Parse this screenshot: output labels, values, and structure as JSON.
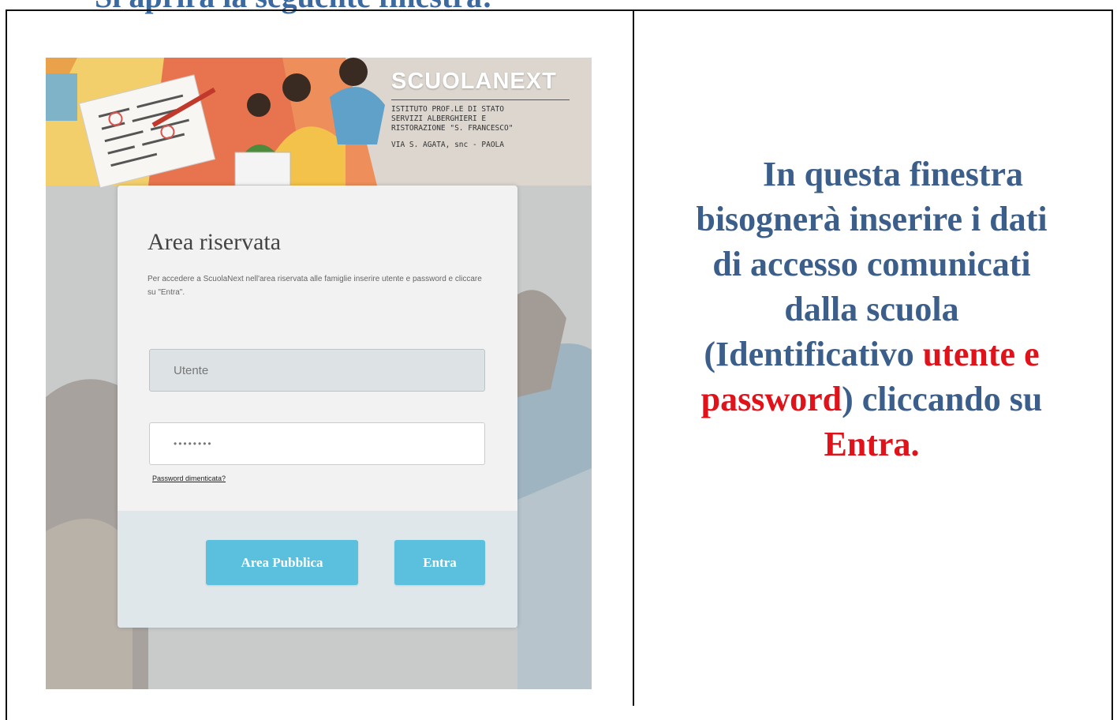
{
  "document": {
    "heading_fragment": "Si aprirà la seguente finestra:"
  },
  "screenshot": {
    "brand": {
      "logo_part1": "SCUOLA",
      "logo_part2": "NEXT"
    },
    "school": {
      "line1": "ISTITUTO PROF.LE DI STATO",
      "line2": "SERVIZI ALBERGHIERI E",
      "line3": "RISTORAZIONE \"S. FRANCESCO\"",
      "address": "VIA S. AGATA, snc - PAOLA"
    },
    "login": {
      "title": "Area riservata",
      "description": "Per accedere a ScuolaNext nell'area riservata alle famiglie inserire utente e password e cliccare su \"Entra\".",
      "username_placeholder": "Utente",
      "password_value": "••••••••",
      "forgot_link": "Password dimenticata?",
      "public_button": "Area Pubblica",
      "enter_button": "Entra"
    },
    "colors": {
      "button": "#5bc0de",
      "card": "#f2f2f2",
      "footer": "#dfe7ea"
    }
  },
  "instructions": {
    "line1": "In questa finestra",
    "line2": "bisognerà inserire i dati",
    "line3": "di accesso comunicati",
    "line4": "dalla scuola",
    "part_open": "(Identificativo ",
    "highlight1": "utente e",
    "highlight2": "password",
    "part_close": ") cliccando su",
    "highlight3": "Entra.",
    "colors": {
      "text": "#3b5f8a",
      "highlight": "#e0131b"
    }
  }
}
